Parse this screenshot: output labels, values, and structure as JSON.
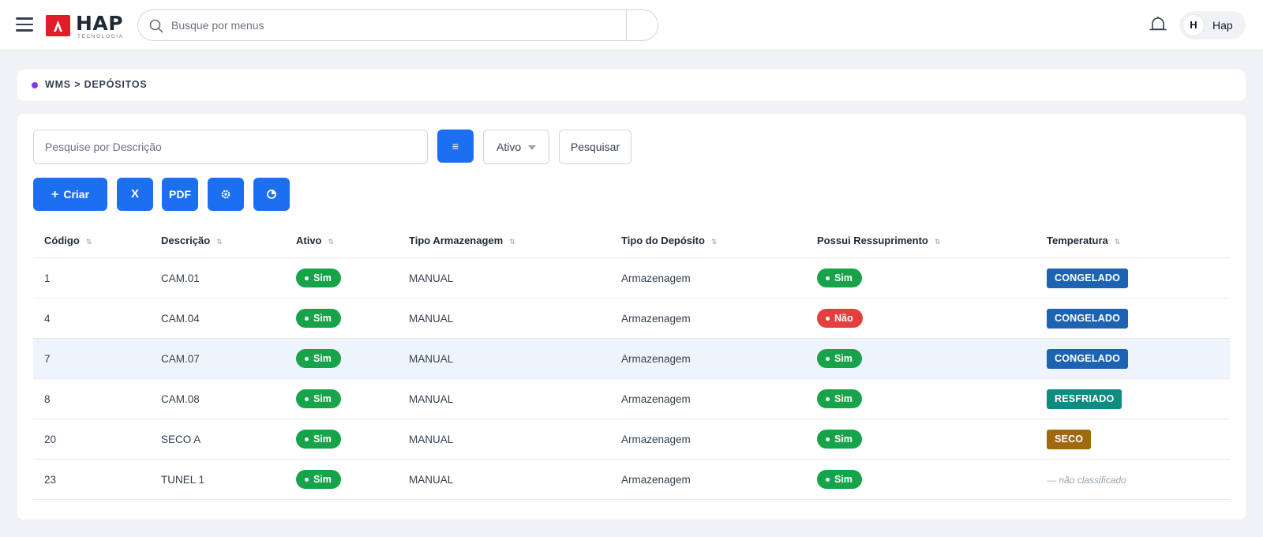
{
  "header": {
    "logo_text": "HAP",
    "logo_subtext": "TECNOLOGIA",
    "search_placeholder": "Busque por menus",
    "user_initial": "H",
    "user_name": "Hap"
  },
  "breadcrumb": "WMS > DEPÓSITOS",
  "filters": {
    "description_placeholder": "Pesquise por Descrição",
    "filter_icon": "≡",
    "status_value": "Ativo",
    "search_label": "Pesquisar"
  },
  "actions": {
    "create_icon": "+",
    "create_label": "Criar",
    "excel_label": "X",
    "pdf_label": "PDF",
    "settings_icon": "gear-icon",
    "chart_icon": "pie-chart-icon"
  },
  "table": {
    "sort_glyph": "⇅",
    "columns": [
      "Código",
      "Descrição",
      "Ativo",
      "Tipo Armazenagem",
      "Tipo do Depósito",
      "Possui Ressuprimento",
      "Temperatura"
    ],
    "rows": [
      {
        "codigo": "1",
        "descricao": "CAM.01",
        "ativo": "Sim",
        "tipo_armazenagem": "MANUAL",
        "tipo_deposito": "Armazenagem",
        "ressuprimento": "Sim",
        "temperatura": "CONGELADO"
      },
      {
        "codigo": "4",
        "descricao": "CAM.04",
        "ativo": "Sim",
        "tipo_armazenagem": "MANUAL",
        "tipo_deposito": "Armazenagem",
        "ressuprimento": "Não",
        "temperatura": "CONGELADO"
      },
      {
        "codigo": "7",
        "descricao": "CAM.07",
        "ativo": "Sim",
        "tipo_armazenagem": "MANUAL",
        "tipo_deposito": "Armazenagem",
        "ressuprimento": "Sim",
        "temperatura": "CONGELADO"
      },
      {
        "codigo": "8",
        "descricao": "CAM.08",
        "ativo": "Sim",
        "tipo_armazenagem": "MANUAL",
        "tipo_deposito": "Armazenagem",
        "ressuprimento": "Sim",
        "temperatura": "RESFRIADO"
      },
      {
        "codigo": "20",
        "descricao": "SECO A",
        "ativo": "Sim",
        "tipo_armazenagem": "MANUAL",
        "tipo_deposito": "Armazenagem",
        "ressuprimento": "Sim",
        "temperatura": "SECO"
      },
      {
        "codigo": "23",
        "descricao": "TUNEL 1",
        "ativo": "Sim",
        "tipo_armazenagem": "MANUAL",
        "tipo_deposito": "Armazenagem",
        "ressuprimento": "Sim",
        "temperatura": "— não classificado"
      }
    ]
  },
  "colors": {
    "primary": "#1d6ff2",
    "success": "#16a34a",
    "danger": "#e53e3e",
    "congelado": "#1e63b2",
    "resfriado": "#0f8c80",
    "seco": "#a0680f",
    "breadcrumb_dot": "#7c3aed",
    "logo_red": "#e11d2a"
  }
}
